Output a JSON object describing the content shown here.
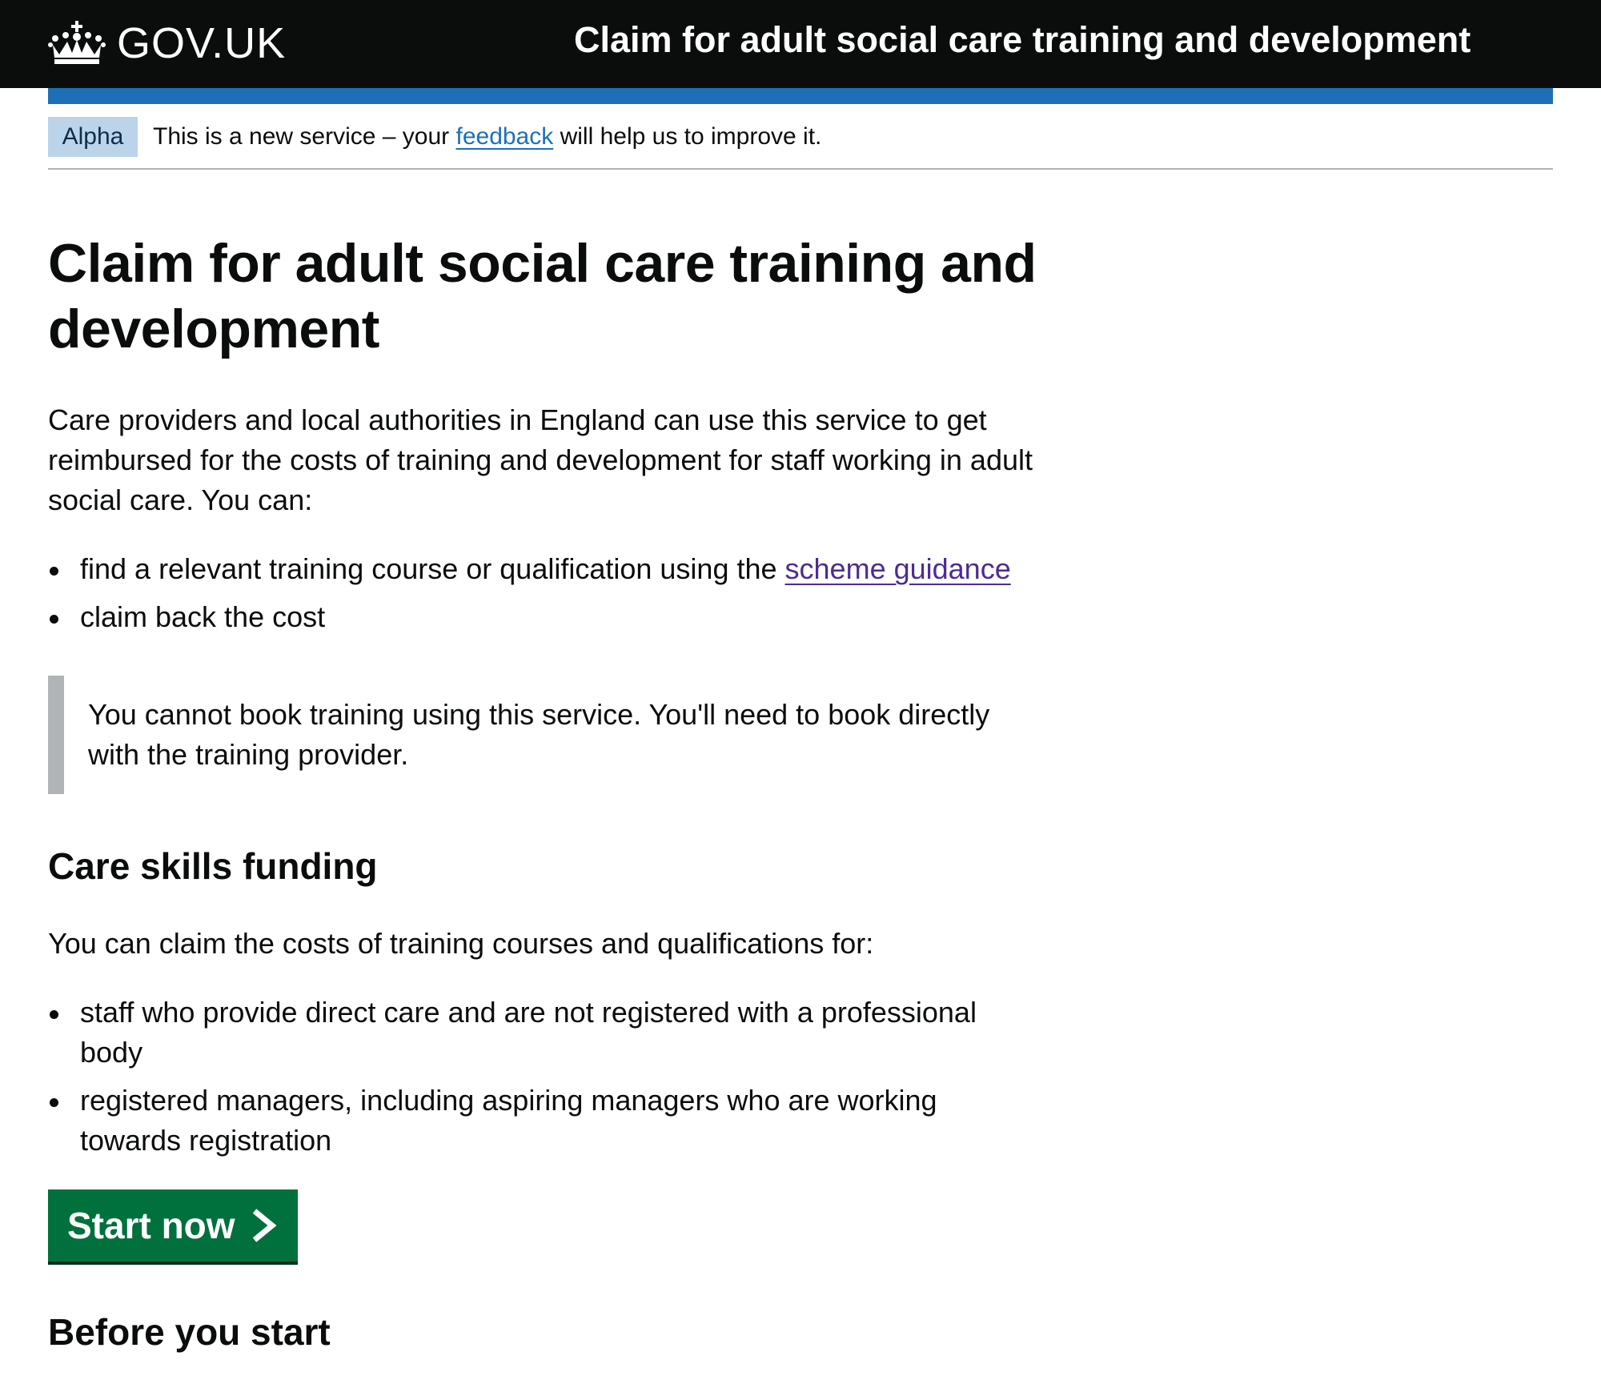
{
  "header": {
    "logo_text": "GOV.UK",
    "service_name": "Claim for adult social care training and development"
  },
  "phase_banner": {
    "tag": "Alpha",
    "text_before": "This is a new service – your ",
    "link_text": "feedback",
    "text_after": " will help us to improve it."
  },
  "main": {
    "title": "Claim for adult social care training and development",
    "intro": "Care providers and local authorities in England can use this service to get reimbursed for the costs of training and development for staff working in adult social care. You can:",
    "bullets": {
      "item1_text": "find a relevant training course or qualification using the ",
      "item1_link": "scheme guidance",
      "item2_text": "claim back the cost"
    },
    "inset_text": "You cannot book training using this service. You'll need to book directly with the training provider.",
    "section_heading": "Care skills funding",
    "section_intro": "You can claim the costs of training courses and qualifications for:",
    "eligible": [
      "staff who provide direct care and are not registered with a professional body",
      "registered managers, including aspiring managers who are working towards registration"
    ],
    "start_button": "Start now",
    "next_heading": "Before you start"
  },
  "icons": {
    "logo": "crown-icon",
    "button": "chevron-right-icon"
  },
  "colors": {
    "header_bg": "#0b0c0c",
    "brand_blue": "#1d70b8",
    "phase_tag_bg": "#bbd4ea",
    "link": "#1d70b8",
    "visited_link": "#4c2c92",
    "start_button": "#00703c",
    "inset_border": "#b1b4b6"
  }
}
